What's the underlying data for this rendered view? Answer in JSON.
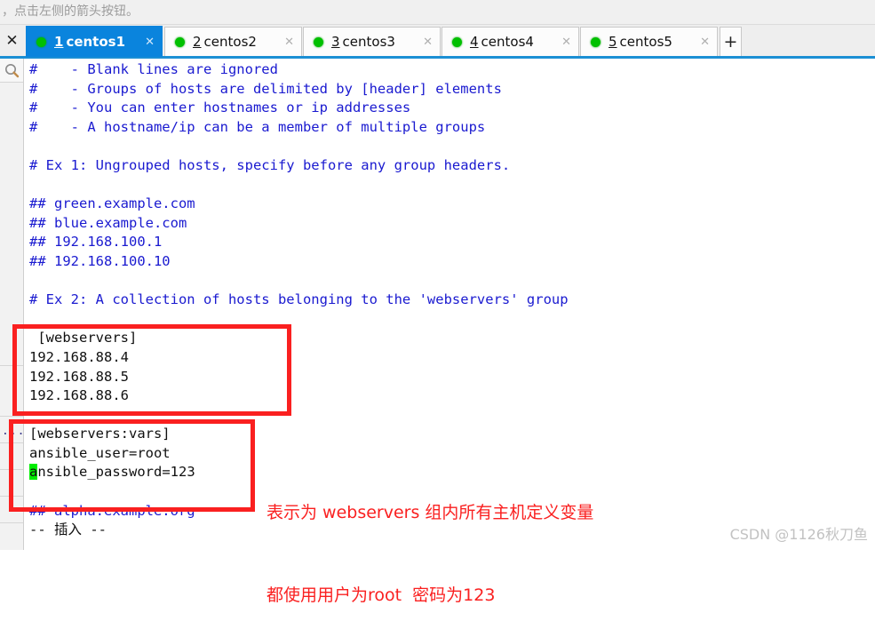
{
  "header": {
    "hint": "，点击左侧的箭头按钮。"
  },
  "tabbar": {
    "close_all_label": "✕",
    "add_tab_label": "+",
    "tab_close_label": "✕",
    "tabs": [
      {
        "index": "1",
        "label": "centos1",
        "status": "connected",
        "active": true
      },
      {
        "index": "2",
        "label": "centos2",
        "status": "connected",
        "active": false
      },
      {
        "index": "3",
        "label": "centos3",
        "status": "connected",
        "active": false
      },
      {
        "index": "4",
        "label": "centos4",
        "status": "connected",
        "active": false
      },
      {
        "index": "5",
        "label": "centos5",
        "status": "connected",
        "active": false
      }
    ]
  },
  "left_rail": {
    "search_icon": "magnifier-icon",
    "dots_label": "..."
  },
  "terminal": {
    "lines": [
      {
        "text": "#    - Blank lines are ignored",
        "style": "comment"
      },
      {
        "text": "#    - Groups of hosts are delimited by [header] elements",
        "style": "comment"
      },
      {
        "text": "#    - You can enter hostnames or ip addresses",
        "style": "comment"
      },
      {
        "text": "#    - A hostname/ip can be a member of multiple groups",
        "style": "comment"
      },
      {
        "text": "",
        "style": "blank"
      },
      {
        "text": "# Ex 1: Ungrouped hosts, specify before any group headers.",
        "style": "comment"
      },
      {
        "text": "",
        "style": "blank"
      },
      {
        "text": "## green.example.com",
        "style": "comment"
      },
      {
        "text": "## blue.example.com",
        "style": "comment"
      },
      {
        "text": "## 192.168.100.1",
        "style": "comment"
      },
      {
        "text": "## 192.168.100.10",
        "style": "comment"
      },
      {
        "text": "",
        "style": "blank"
      },
      {
        "text": "# Ex 2: A collection of hosts belonging to the 'webservers' group",
        "style": "comment"
      },
      {
        "text": "",
        "style": "blank"
      },
      {
        "text": " [webservers]",
        "style": "plain"
      },
      {
        "text": "192.168.88.4",
        "style": "plain"
      },
      {
        "text": "192.168.88.5",
        "style": "plain"
      },
      {
        "text": "192.168.88.6",
        "style": "plain"
      },
      {
        "text": "",
        "style": "blank"
      },
      {
        "text": "[webservers:vars]",
        "style": "plain"
      },
      {
        "text": "ansible_user=root",
        "style": "plain"
      },
      {
        "text": "ansible_password=123",
        "style": "plain",
        "cursor_at": 0
      },
      {
        "text": "",
        "style": "blank"
      },
      {
        "text": "## alpha.example.org",
        "style": "comment"
      },
      {
        "text": "-- 插入 --",
        "style": "plain"
      }
    ],
    "status_line": "-- 插入 --"
  },
  "annotation": {
    "line1": "表示为 webservers 组内所有主机定义变量",
    "line2": "都使用用户为root  密码为123"
  },
  "watermark": {
    "text": "CSDN @1126秋刀鱼"
  },
  "colors": {
    "tab_active": "#0a84dd",
    "tab_bar_underline": "#1b8fd4",
    "terminal_comment": "#1a1ad0",
    "terminal_text": "#101010",
    "annotation_red": "#fa2020",
    "status_dot_green": "#00c000",
    "cursor_green": "#00ee00"
  }
}
